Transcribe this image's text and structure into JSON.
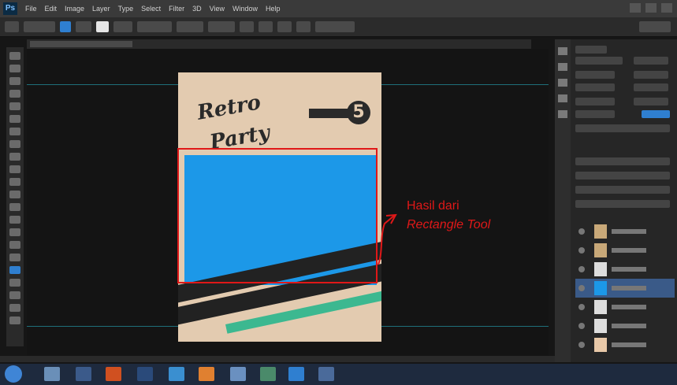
{
  "app": {
    "name": "Adobe Photoshop"
  },
  "menubar": {
    "items": [
      "File",
      "Edit",
      "Image",
      "Layer",
      "Type",
      "Select",
      "Filter",
      "3D",
      "View",
      "Window",
      "Help"
    ]
  },
  "poster": {
    "badge_number": "5"
  },
  "annotation": {
    "line1": "Hasil dari",
    "line2": "Rectangle Tool"
  },
  "colors": {
    "highlight": "#e01818",
    "rectangle_fill": "#1c98e8",
    "poster_bg": "#e3cbb0",
    "accent": "#2f7fd0"
  }
}
